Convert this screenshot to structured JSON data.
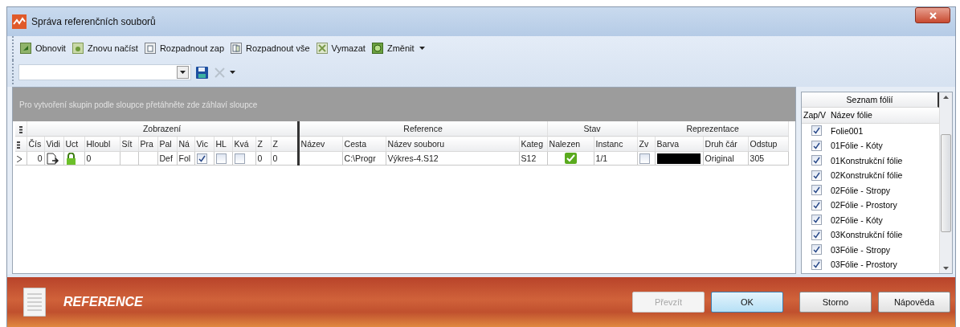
{
  "window": {
    "title": "Správa referenčních souborů"
  },
  "toolbar": {
    "buttons": [
      {
        "label": "Obnovit",
        "kind": "refresh"
      },
      {
        "label": "Znovu načíst",
        "kind": "reload"
      },
      {
        "label": "Rozpadnout zap",
        "kind": "explode"
      },
      {
        "label": "Rozpadnout vše",
        "kind": "explode-all"
      },
      {
        "label": "Vymazat",
        "kind": "delete"
      },
      {
        "label": "Změnit",
        "kind": "change"
      }
    ],
    "delete_disabled": true
  },
  "grid": {
    "group_panel_hint": "Pro vytvoření skupin podle sloupce přetáhněte zde záhlaví sloupce",
    "bands": [
      {
        "label": "Zobrazení",
        "columns": [
          "Čís",
          "Vidi",
          "Uct",
          "Hloubl",
          "Sít",
          "Pra",
          "Pal",
          "Ná",
          "Vic",
          "HL",
          "Kvá",
          "Z",
          "Z"
        ]
      },
      {
        "label": "Reference",
        "columns": [
          "Název",
          "Cesta",
          "Název souboru",
          "Kateg"
        ]
      },
      {
        "label": "Stav",
        "columns": [
          "Nalezen",
          "Instanc"
        ]
      },
      {
        "label": "Reprezentace",
        "columns": [
          "Zv",
          "Barva",
          "Druh čár",
          "Odstup"
        ]
      }
    ],
    "rows": [
      {
        "selected": true,
        "cells": [
          {
            "kind": "text",
            "text": "0"
          },
          {
            "kind": "doc"
          },
          {
            "kind": "lock"
          },
          {
            "kind": "text",
            "text": "0"
          },
          {
            "kind": "empty"
          },
          {
            "kind": "empty"
          },
          {
            "kind": "text",
            "text": "Def"
          },
          {
            "kind": "text",
            "text": "Fol"
          },
          {
            "kind": "check",
            "checked": true
          },
          {
            "kind": "check",
            "checked": false
          },
          {
            "kind": "check",
            "checked": false
          },
          {
            "kind": "text",
            "text": "0"
          },
          {
            "kind": "text",
            "text": "0"
          },
          {
            "kind": "empty"
          },
          {
            "kind": "text",
            "text": "C:\\Progr"
          },
          {
            "kind": "text",
            "text": "Výkres-4.S12"
          },
          {
            "kind": "text",
            "text": "S12"
          },
          {
            "kind": "status",
            "found": true
          },
          {
            "kind": "text",
            "text": "1/1"
          },
          {
            "kind": "check",
            "checked": false
          },
          {
            "kind": "swatch",
            "color": "#000000"
          },
          {
            "kind": "text",
            "text": "Original"
          },
          {
            "kind": "text",
            "text": "305"
          }
        ]
      }
    ]
  },
  "layers": {
    "title": "Seznam fólií",
    "columns": [
      "Zap/V",
      "Název fólie"
    ],
    "items": [
      {
        "name": "Folie001",
        "checked": true
      },
      {
        "name": "01Fólie - Kóty",
        "checked": true
      },
      {
        "name": "01Konstrukční fólie",
        "checked": true
      },
      {
        "name": "02Konstrukční fólie",
        "checked": true
      },
      {
        "name": "02Fólie - Stropy",
        "checked": true
      },
      {
        "name": "02Fólie - Prostory",
        "checked": true
      },
      {
        "name": "02Fólie - Kóty",
        "checked": true
      },
      {
        "name": "03Konstrukční fólie",
        "checked": true
      },
      {
        "name": "03Fólie - Stropy",
        "checked": true
      },
      {
        "name": "03Fólie - Prostory",
        "checked": true
      }
    ]
  },
  "footer": {
    "title": "REFERENCE",
    "buttons": [
      {
        "label": "Převzít",
        "disabled": true,
        "default": false
      },
      {
        "label": "OK",
        "disabled": false,
        "default": true
      },
      {
        "label": "Storno",
        "disabled": false,
        "default": false
      },
      {
        "label": "Nápověda",
        "disabled": false,
        "default": false
      }
    ]
  }
}
